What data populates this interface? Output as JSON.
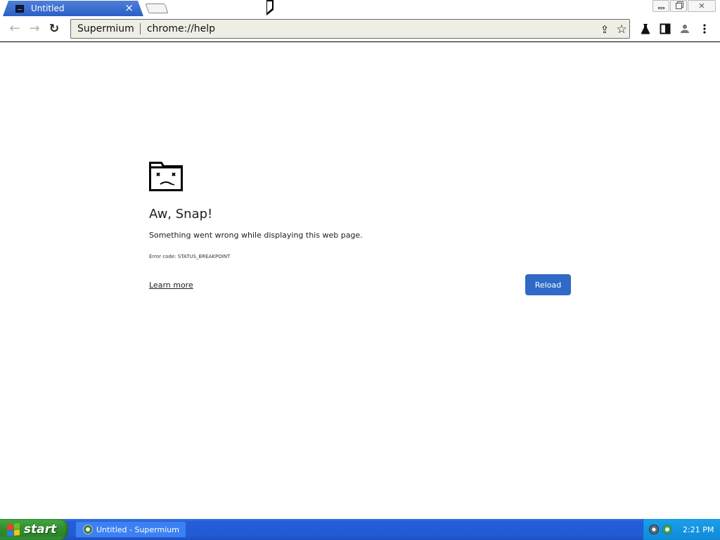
{
  "browser": {
    "tab": {
      "title": "Untitled",
      "close_glyph": "×"
    },
    "window_controls": [
      "minimize",
      "maximize",
      "close"
    ],
    "window_close_glyph": "✕",
    "toolbar": {
      "back_glyph": "←",
      "forward_glyph": "→",
      "reload_glyph": "↻",
      "omnibox": {
        "chip": "Supermium",
        "url": "chrome://help"
      },
      "share_glyph": "⇪",
      "star_glyph": "☆"
    },
    "icons": [
      "share-icon",
      "star-icon",
      "flask-icon",
      "side-panel-icon",
      "profile-icon",
      "menu-icon"
    ]
  },
  "error_page": {
    "title": "Aw, Snap!",
    "message": "Something went wrong while displaying this web page.",
    "error_code": "Error code: STATUS_BREAKPOINT",
    "learn_more": "Learn more",
    "reload_label": "Reload",
    "accent_color": "#2e6ac6"
  },
  "taskbar": {
    "start_label": "start",
    "task_item": "Untitled - Supermium",
    "clock": "2:21 PM"
  }
}
